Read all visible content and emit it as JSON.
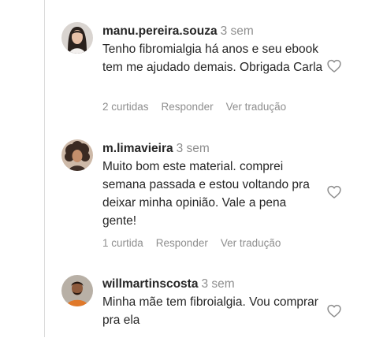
{
  "comments": [
    {
      "username": "manu.pereira.souza",
      "time": "3 sem",
      "text": "Tenho fibromialgia há anos e seu ebook tem me ajudado demais. Obrigada Carla",
      "likes": "2 curtidas",
      "reply_label": "Responder",
      "translate_label": "Ver tradução",
      "avatar_icon": "profile-photo-woman-long-dark-hair"
    },
    {
      "username": "m.limavieira",
      "time": "3 sem",
      "text": "Muito bom este material. comprei semana passada e estou voltando pra deixar minha opinião. Vale a pena gente!",
      "likes": "1 curtida",
      "reply_label": "Responder",
      "translate_label": "Ver tradução",
      "avatar_icon": "profile-photo-woman-curly-hair"
    },
    {
      "username": "willmartinscosta",
      "time": "3 sem",
      "text": "Minha mãe tem fibroialgia. Vou comprar pra ela",
      "avatar_icon": "profile-photo-man-orange-shirt"
    }
  ],
  "colors": {
    "text": "#262626",
    "muted": "#8e8e8e",
    "thread_line": "#dbdbdb"
  },
  "icons": {
    "like": "heart-outline-icon"
  }
}
